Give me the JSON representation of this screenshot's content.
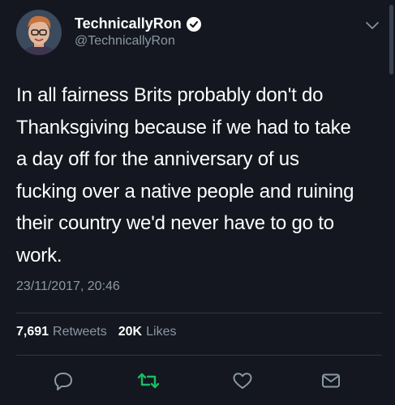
{
  "user": {
    "display_name": "TechnicallyRon",
    "handle": "@TechnicallyRon",
    "verified": true
  },
  "tweet": {
    "text": "In all fairness Brits probably don't do\nThanksgiving because if we had to take\na day off for the anniversary of us\nfucking over a native people and ruining\ntheir country we'd never have to go to\nwork.",
    "timestamp": "23/11/2017, 20:46"
  },
  "stats": {
    "retweets_count": "7,691",
    "retweets_label": "Retweets",
    "likes_count": "20K",
    "likes_label": "Likes"
  },
  "actions": {
    "reply_icon": "reply-icon",
    "retweet_icon": "retweet-icon",
    "like_icon": "heart-icon",
    "dm_icon": "envelope-icon"
  },
  "colors": {
    "background": "#14171f",
    "secondary_text": "#8b98a5",
    "retweet_active": "#17bf63",
    "divider": "#2f3641"
  }
}
